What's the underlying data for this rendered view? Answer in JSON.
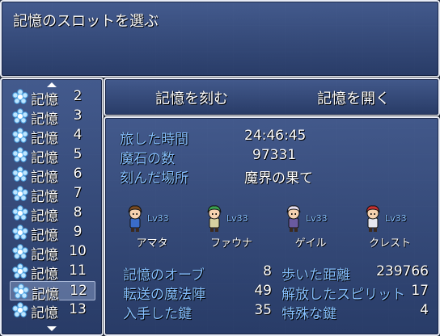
{
  "help": {
    "text": "記憶のスロットを選ぶ"
  },
  "slots": [
    {
      "label": "記憶",
      "num": "2"
    },
    {
      "label": "記憶",
      "num": "3"
    },
    {
      "label": "記憶",
      "num": "4"
    },
    {
      "label": "記憶",
      "num": "5"
    },
    {
      "label": "記憶",
      "num": "6"
    },
    {
      "label": "記憶",
      "num": "7"
    },
    {
      "label": "記憶",
      "num": "8"
    },
    {
      "label": "記憶",
      "num": "9"
    },
    {
      "label": "記憶",
      "num": "10"
    },
    {
      "label": "記憶",
      "num": "11"
    },
    {
      "label": "記憶",
      "num": "12"
    },
    {
      "label": "記憶",
      "num": "13"
    }
  ],
  "selected_slot": "12",
  "commands": {
    "save": "記憶を刻む",
    "load": "記憶を開く"
  },
  "info": {
    "playtime_label": "旅した時間",
    "playtime": "24:46:45",
    "gold_label": "魔石の数",
    "gold": "97331",
    "location_label": "刻んだ場所",
    "location": "魔界の果て"
  },
  "party": [
    {
      "name": "アマタ",
      "level": "Lv33",
      "hair": "#7a4a20",
      "body": "#3a6cc8"
    },
    {
      "name": "ファウナ",
      "level": "Lv33",
      "hair": "#3aa050",
      "body": "#d8d0a0"
    },
    {
      "name": "ゲイル",
      "level": "Lv33",
      "hair": "#e8e0f0",
      "body": "#6a5aa0"
    },
    {
      "name": "クレスト",
      "level": "Lv33",
      "hair": "#c83030",
      "body": "#e8e8f0"
    }
  ],
  "stats": {
    "orb_label": "記憶のオーブ",
    "orb": "8",
    "steps_label": "歩いた距離",
    "steps": "239766",
    "circle_label": "転送の魔法陣",
    "circle": "49",
    "spirit_label": "解放したスピリット",
    "spirit": "17",
    "keys_label": "入手した鍵",
    "keys": "35",
    "special_label": "特殊な鍵",
    "special": "4"
  },
  "colors": {
    "system_text": "#86c0ff",
    "window_border": "#e8ecf6"
  }
}
